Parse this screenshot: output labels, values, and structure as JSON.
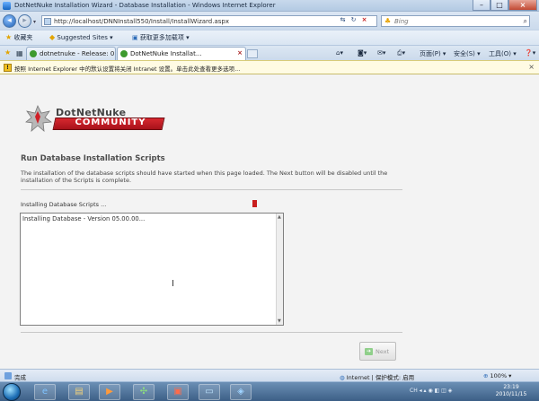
{
  "window": {
    "title": "DotNetNuke Installation Wizard - Database Installation - Windows Internet Explorer",
    "minimize": "–",
    "maximize": "□",
    "close": "×"
  },
  "address_bar": {
    "url": "http://localhost/DNNInstall550/Install/InstallWizard.aspx",
    "search_engine": "Bing",
    "refresh": "↻",
    "stop": "×",
    "compat": "⇆"
  },
  "favorites_bar": {
    "favorites_label": "收藏夹",
    "suggested_sites": "Suggested Sites ▾",
    "get_more_addons": "获取更多加载项 ▾"
  },
  "tabs": [
    {
      "label": "dotnetnuke - Release: 0..."
    },
    {
      "label": "DotNetNuke Installat..."
    }
  ],
  "command_bar": {
    "page_menu": "页面(P) ▾",
    "safety_menu": "安全(S) ▾",
    "tools_menu": "工具(O) ▾",
    "help_menu": "❓▾"
  },
  "info_bar": {
    "message": "按照 Internet Explorer 中的默认设置将关闭 Intranet 设置。单击此处查看更多选项..."
  },
  "content": {
    "brand": "DotNetNuke",
    "brand_ribbon": "COMMUNITY",
    "heading": "Run Database Installation Scripts",
    "description": "The installation of the database scripts should have started when this page loaded. The Next button will be disabled until the installation of the Scripts is complete.",
    "status_label": "Installing Database Scripts ...",
    "log_text": "Installing Database - Version 05.00.00...",
    "next_button": "Next"
  },
  "status_bar": {
    "done": "完成",
    "zone": "Internet | 保护模式: 启用",
    "zoom": "100% ▾"
  },
  "taskbar": {
    "tray": "CH ◂ ▴ ◉ ◧ ◫ ◈",
    "time": "23:19",
    "date": "2010/11/15"
  }
}
